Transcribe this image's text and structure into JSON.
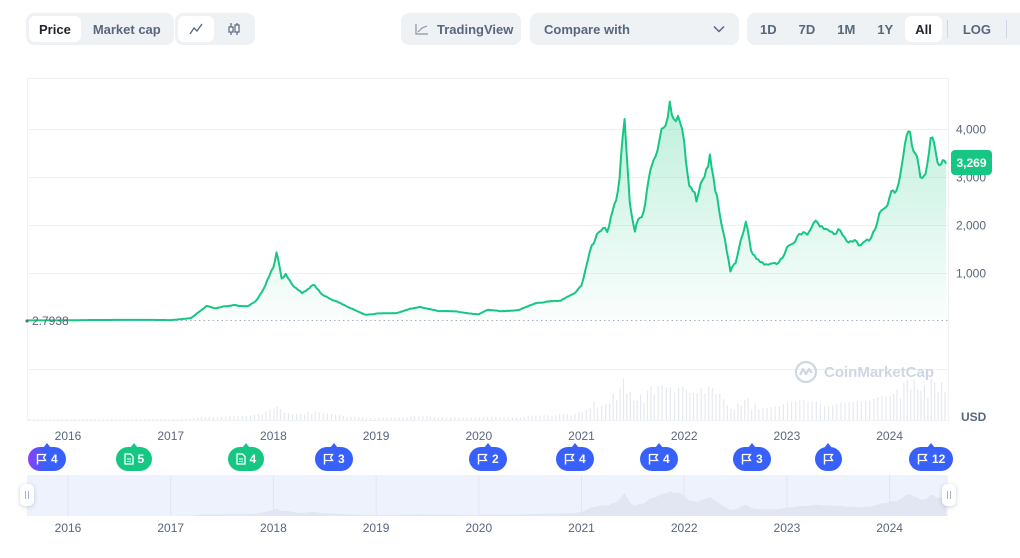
{
  "toolbar": {
    "view_tabs": [
      {
        "label": "Price",
        "active": true
      },
      {
        "label": "Market cap",
        "active": false
      }
    ],
    "chart_type": [
      {
        "icon": "line-chart-icon",
        "active": true
      },
      {
        "icon": "candlestick-icon",
        "active": false
      }
    ],
    "tradingview_label": "TradingView",
    "compare_label": "Compare with",
    "ranges": [
      {
        "label": "1D",
        "active": false
      },
      {
        "label": "7D",
        "active": false
      },
      {
        "label": "1M",
        "active": false
      },
      {
        "label": "1Y",
        "active": false
      },
      {
        "label": "All",
        "active": true
      }
    ],
    "log_label": "LOG",
    "more_label": "···"
  },
  "chart": {
    "current_price_label": "3,269",
    "start_price_label": "2.7938",
    "currency_label": "USD",
    "watermark": "CoinMarketCap",
    "colors": {
      "line": "#16c784",
      "fill": "#16c784",
      "grid": "#eff2f5",
      "navigator_fill": "#eff2f5",
      "navigator_bg": "#eef2fd",
      "volume": "#e6e9f0"
    }
  },
  "markers": [
    {
      "type": "flag",
      "count": "4",
      "color": "purple"
    },
    {
      "type": "document",
      "count": "5",
      "color": "green"
    },
    {
      "type": "document",
      "count": "4",
      "color": "green"
    },
    {
      "type": "flag",
      "count": "3",
      "color": "blue"
    },
    {
      "type": "flag",
      "count": "2",
      "color": "blue"
    },
    {
      "type": "flag",
      "count": "4",
      "color": "blue"
    },
    {
      "type": "flag",
      "count": "4",
      "color": "blue"
    },
    {
      "type": "flag",
      "count": "3",
      "color": "blue"
    },
    {
      "type": "flag",
      "count": "",
      "color": "blue"
    },
    {
      "type": "flag",
      "count": "12",
      "color": "blue"
    }
  ],
  "chart_data": {
    "type": "area",
    "title": "",
    "xlabel": "",
    "ylabel": "USD",
    "x_tick_labels": [
      "2016",
      "2017",
      "2018",
      "2019",
      "2020",
      "2021",
      "2022",
      "2023",
      "2024"
    ],
    "y_tick_labels": [
      "1,000",
      "2,000",
      "3,000",
      "4,000"
    ],
    "y_ticks": [
      1000,
      2000,
      3000,
      4000
    ],
    "ylim": [
      0,
      4900
    ],
    "xlim": [
      2015.6,
      2024.55
    ],
    "grid": true,
    "legend": "none",
    "series": [
      {
        "name": "Price",
        "x": [
          2015.6,
          2015.9,
          2016.2,
          2016.5,
          2016.8,
          2017.0,
          2017.2,
          2017.35,
          2017.45,
          2017.55,
          2017.65,
          2017.75,
          2017.85,
          2017.92,
          2018.0,
          2018.03,
          2018.08,
          2018.12,
          2018.2,
          2018.28,
          2018.35,
          2018.4,
          2018.5,
          2018.6,
          2018.75,
          2018.9,
          2019.0,
          2019.2,
          2019.35,
          2019.45,
          2019.6,
          2019.8,
          2020.0,
          2020.1,
          2020.2,
          2020.4,
          2020.55,
          2020.65,
          2020.8,
          2020.95,
          2021.0,
          2021.1,
          2021.15,
          2021.25,
          2021.32,
          2021.37,
          2021.42,
          2021.47,
          2021.52,
          2021.57,
          2021.62,
          2021.67,
          2021.72,
          2021.78,
          2021.82,
          2021.86,
          2021.9,
          2021.94,
          2022.0,
          2022.05,
          2022.12,
          2022.18,
          2022.25,
          2022.32,
          2022.38,
          2022.45,
          2022.5,
          2022.55,
          2022.6,
          2022.65,
          2022.72,
          2022.8,
          2022.9,
          2023.0,
          2023.1,
          2023.2,
          2023.3,
          2023.4,
          2023.5,
          2023.6,
          2023.7,
          2023.8,
          2023.9,
          2024.0,
          2024.05,
          2024.1,
          2024.15,
          2024.2,
          2024.25,
          2024.3,
          2024.35,
          2024.4,
          2024.45,
          2024.5,
          2024.55
        ],
        "y": [
          2.79,
          1,
          10,
          12,
          12,
          8,
          50,
          300,
          250,
          300,
          320,
          300,
          450,
          700,
          1100,
          1380,
          900,
          1000,
          700,
          550,
          650,
          750,
          500,
          400,
          250,
          120,
          140,
          160,
          250,
          280,
          200,
          180,
          130,
          230,
          200,
          220,
          350,
          380,
          400,
          600,
          750,
          1600,
          1800,
          1900,
          2500,
          2900,
          4200,
          2500,
          1800,
          2200,
          2400,
          3100,
          3500,
          4000,
          4150,
          4700,
          4300,
          4300,
          3800,
          2800,
          2500,
          3000,
          3500,
          2600,
          1800,
          1000,
          1200,
          1700,
          2000,
          1500,
          1300,
          1200,
          1200,
          1500,
          1700,
          1800,
          2100,
          1900,
          1850,
          1600,
          1600,
          1700,
          2200,
          2500,
          2700,
          3000,
          3600,
          4050,
          3400,
          3000,
          3100,
          3700,
          3600,
          3200,
          3269
        ]
      }
    ]
  }
}
